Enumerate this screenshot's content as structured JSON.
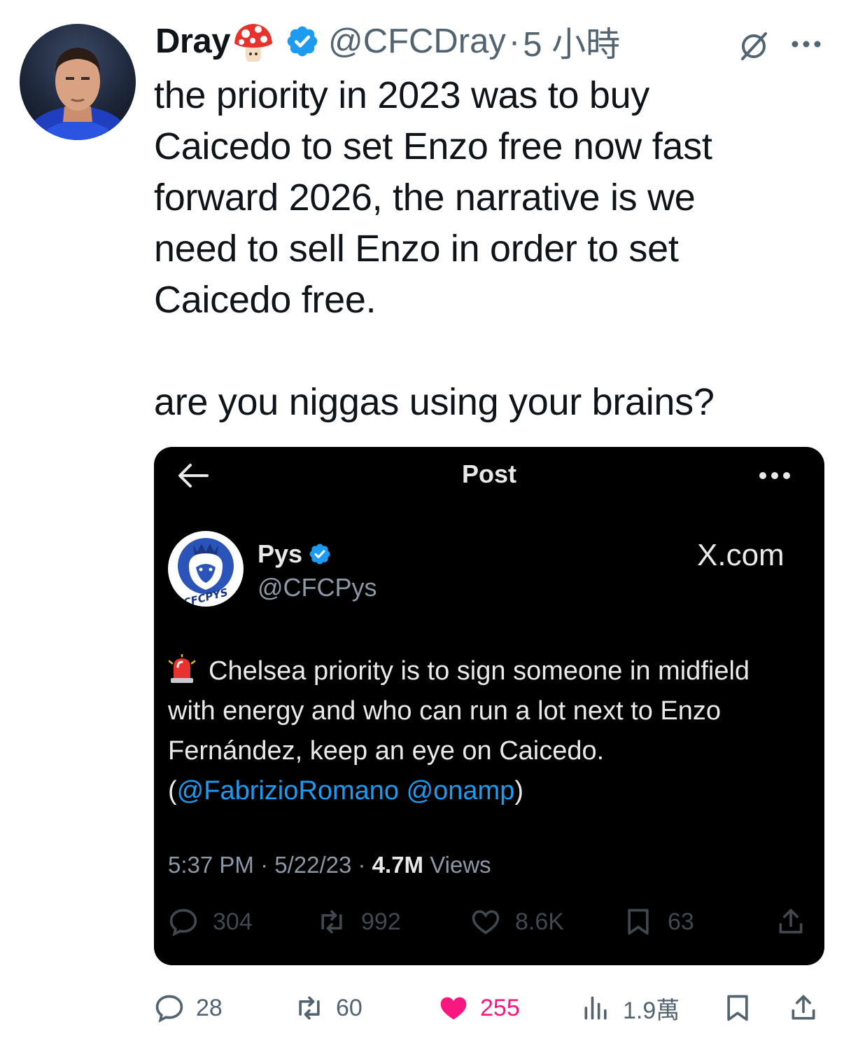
{
  "author": {
    "name": "Dray",
    "handle": "@CFCDray",
    "separator": "·",
    "time": "5 小時"
  },
  "icons": {
    "name_emoji": "mushroom-icon",
    "verified": "verified-badge-icon",
    "grok": "grok-icon",
    "more": "more-options-icon"
  },
  "tweet": {
    "lines": [
      "the priority in 2023 was to buy",
      "Caicedo to set Enzo free now fast",
      "forward 2026, the narrative is we",
      "need to sell Enzo in order to set",
      "Caicedo free."
    ],
    "line_after_gap": "are you niggas using your brains?"
  },
  "embedded_post": {
    "header_title": "Post",
    "author_name": "Pys",
    "author_handle": "@CFCPys",
    "logo_text": "CFCPYS",
    "watermark": "X.com",
    "body_line1": "Chelsea priority is to sign someone in midfield",
    "body_line2": "with energy and who can run a lot next to Enzo",
    "body_line3": "Fernández, keep an eye on Caicedo.",
    "body_line4_open": "(",
    "mention1": "@FabrizioRomano",
    "mention_space": " ",
    "mention2": "@onamp",
    "body_line4_close": ")",
    "meta_time": "5:37 PM",
    "meta_sep": " · ",
    "meta_date": "5/22/23",
    "meta_sep2": " · ",
    "meta_views_count": "4.7M",
    "meta_views_label": " Views",
    "stats": {
      "replies": "304",
      "reposts": "992",
      "likes": "8.6K",
      "bookmarks": "63"
    }
  },
  "actions": {
    "replies": "28",
    "reposts": "60",
    "likes": "255",
    "views": "1.9萬"
  },
  "colors": {
    "accent": "#1d9bf0",
    "like": "#f91880",
    "muted": "#536471",
    "embed_bg": "#000000"
  }
}
